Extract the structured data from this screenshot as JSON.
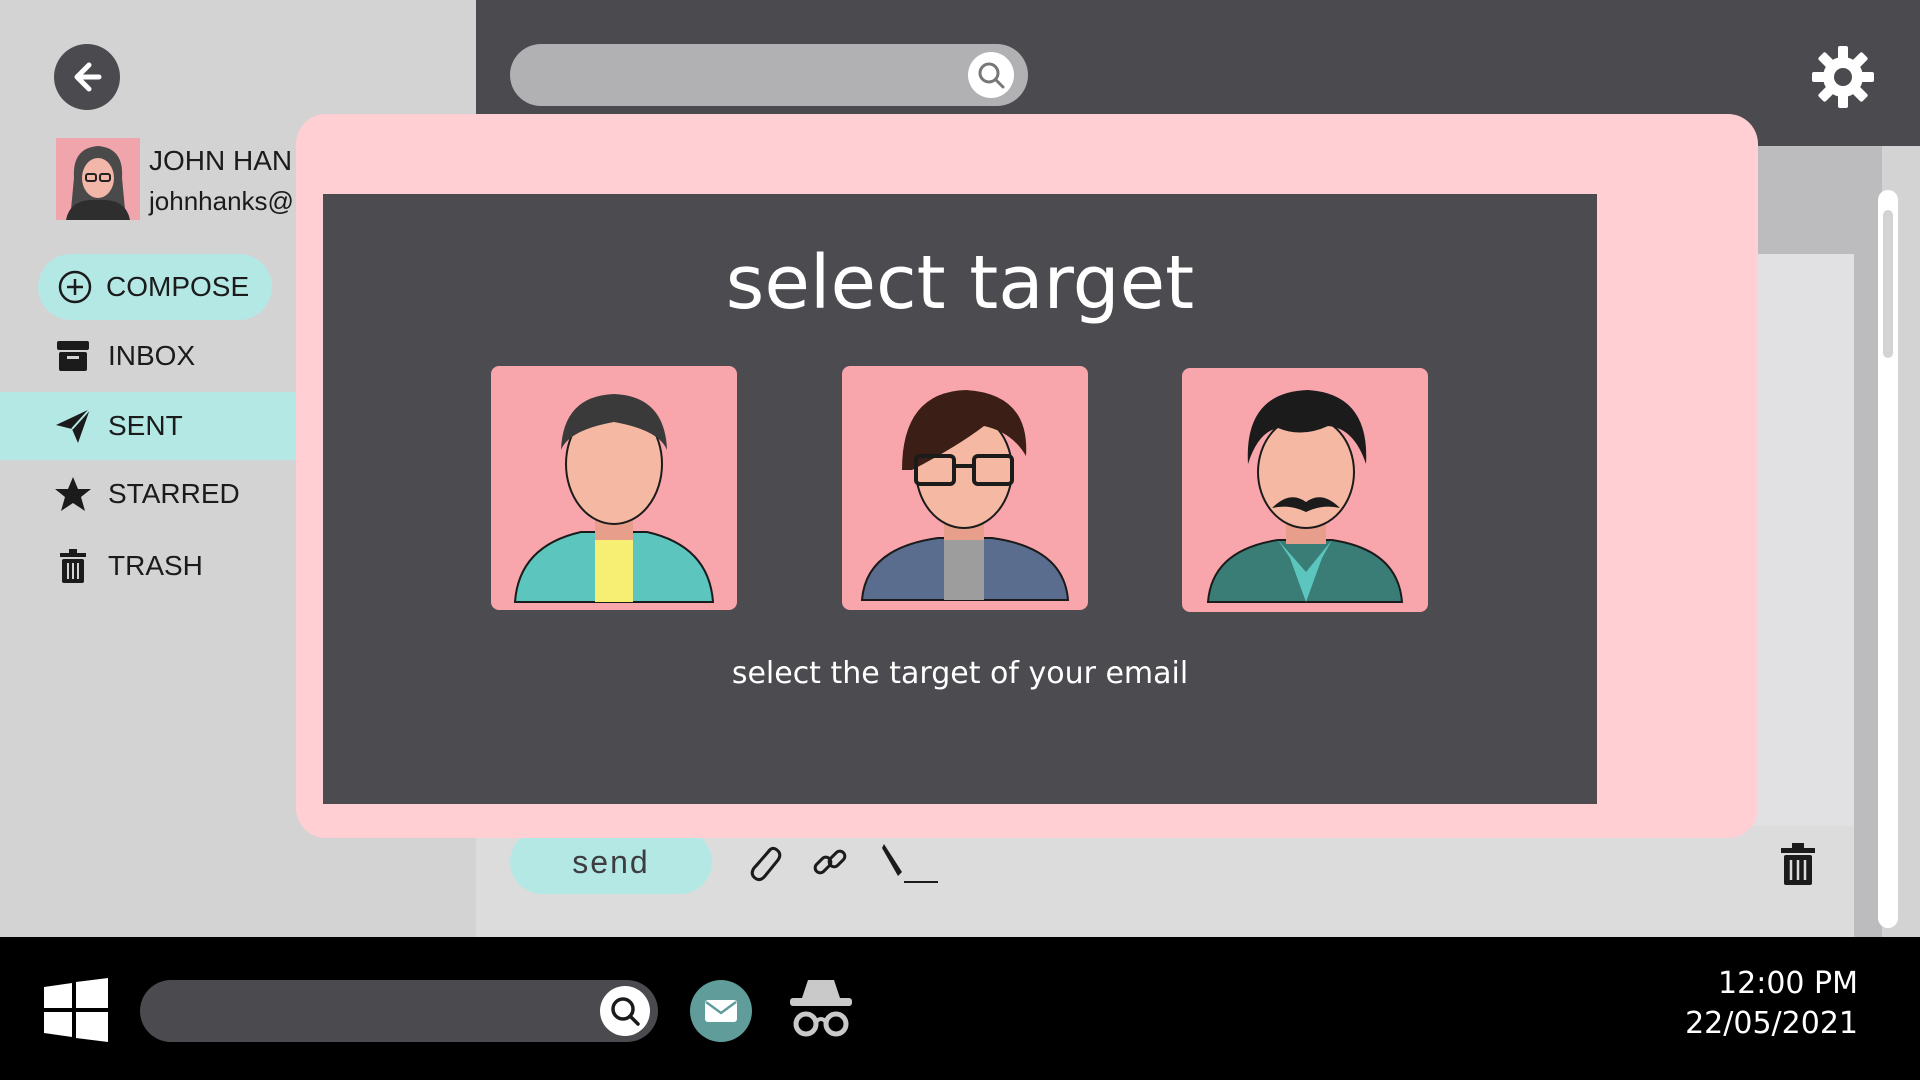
{
  "colors": {
    "sidebar_bg": "#d3d3d3",
    "dark": "#4b4b4f",
    "accent_teal": "#b4e8e5",
    "modal_pink": "#ffcfd3",
    "avatar_pink": "#f8a5ac",
    "taskbar": "#000000"
  },
  "profile": {
    "name": "JOHN HAN",
    "email": "johnhanks@"
  },
  "sidebar": {
    "compose_label": "COMPOSE",
    "items": [
      {
        "label": "INBOX",
        "icon": "archive-icon"
      },
      {
        "label": "SENT",
        "icon": "paper-plane-icon",
        "active": true
      },
      {
        "label": "STARRED",
        "icon": "star-icon"
      },
      {
        "label": "TRASH",
        "icon": "trash-icon"
      }
    ]
  },
  "composer": {
    "send_label": "send",
    "tools": [
      "paperclip-icon",
      "link-icon",
      "pen-signature-icon"
    ]
  },
  "modal": {
    "title": "select target",
    "subtitle": "select the target of your email",
    "targets": [
      {
        "icon": "man-avatar-yellow-shirt"
      },
      {
        "icon": "man-avatar-glasses"
      },
      {
        "icon": "man-avatar-mustache"
      }
    ]
  },
  "taskbar": {
    "time": "12:00 PM",
    "date": "22/05/2021"
  }
}
